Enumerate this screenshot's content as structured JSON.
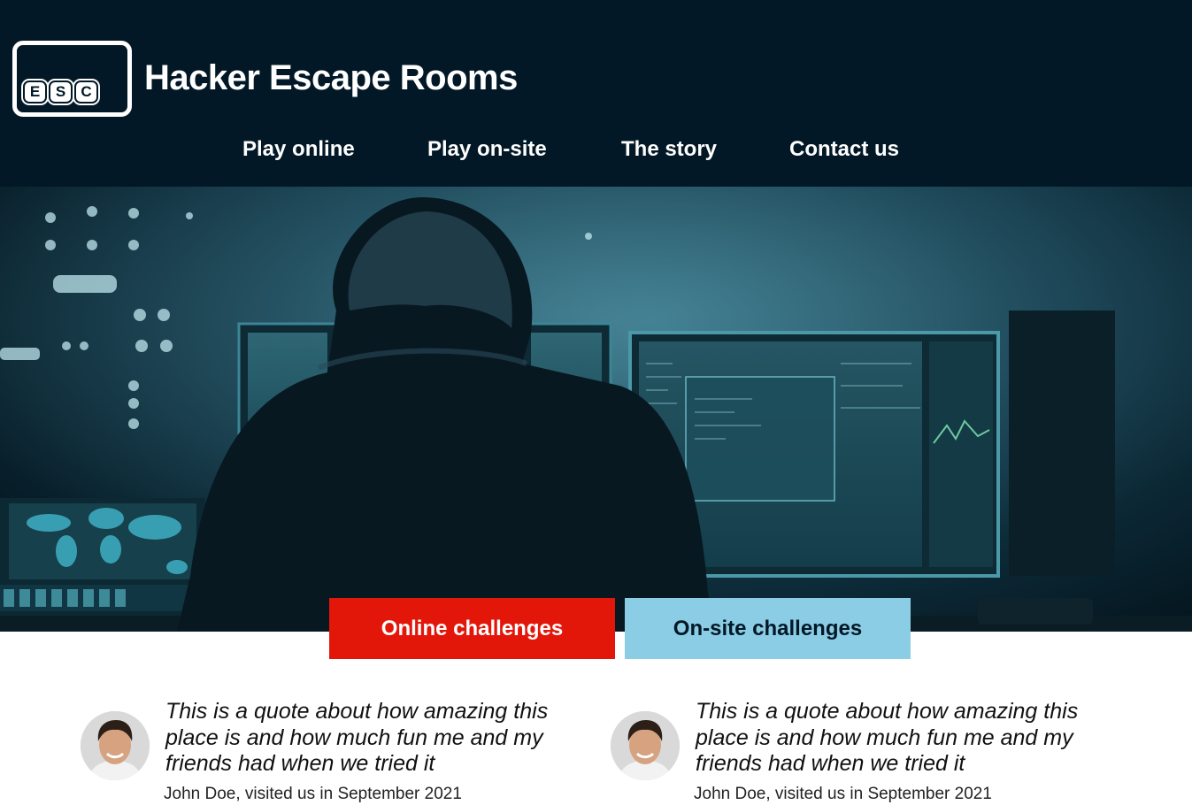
{
  "brand": {
    "logo_text": "ESC",
    "title": "Hacker Escape Rooms"
  },
  "nav": {
    "items": [
      {
        "label": "Play online"
      },
      {
        "label": "Play on-site"
      },
      {
        "label": "The story"
      },
      {
        "label": "Contact us"
      }
    ]
  },
  "hero": {
    "image": "hooded-hacker-at-computer-monitors",
    "buttons": {
      "online": "Online challenges",
      "onsite": "On-site challenges"
    }
  },
  "testimonials": [
    {
      "quote": "This is a quote about how amazing this place is and how much fun me and my friends had when we tried it",
      "attribution": "John Doe, visited us in September 2021"
    },
    {
      "quote": "This is a quote about how amazing this place is and how much fun me and my friends had when we tried it",
      "attribution": "John Doe, visited us in September 2021"
    }
  ],
  "colors": {
    "header_bg": "#021826",
    "online_button": "#e2170a",
    "onsite_button": "#8ccde6"
  }
}
